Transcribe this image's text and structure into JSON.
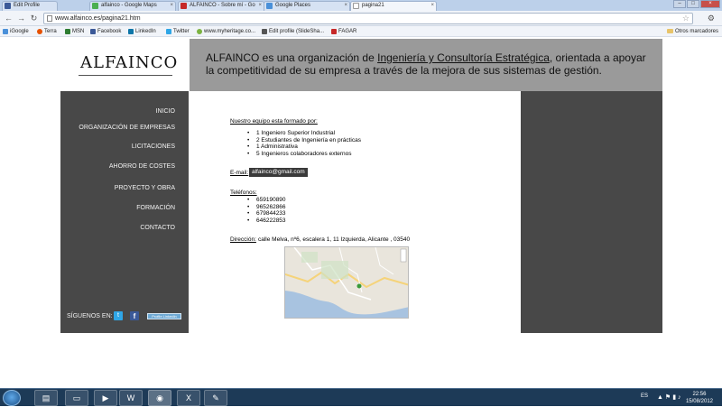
{
  "browser": {
    "tabs": [
      {
        "label": "Edit Profile",
        "color": "#3b5998"
      },
      {
        "label": "alfainco - Google Maps",
        "color": "#4caf50"
      },
      {
        "label": "ALFAINCO - Sobre mí - Go",
        "color": "#c62828"
      },
      {
        "label": "Google Places",
        "color": "#4a90d9"
      },
      {
        "label": "pagina21",
        "color": "#ffffff"
      }
    ],
    "url": "www.alfainco.es/pagina21.htm",
    "bookmarks": [
      {
        "label": "iGoogle",
        "color": "#4a90d9"
      },
      {
        "label": "Terra",
        "color": "#e65100"
      },
      {
        "label": "MSN",
        "color": "#2e7d32"
      },
      {
        "label": "Facebook",
        "color": "#3b5998"
      },
      {
        "label": "LinkedIn",
        "color": "#0e76a8"
      },
      {
        "label": "Twitter",
        "color": "#2fa6e6"
      },
      {
        "label": "www.myheritage.co...",
        "color": "#7cb342"
      },
      {
        "label": "Edit profile (SlideSha...",
        "color": "#555555"
      },
      {
        "label": "FAGAR",
        "color": "#c62828"
      }
    ],
    "other_bookmarks": "Otros marcadores"
  },
  "site": {
    "logo": "ALFAINCO",
    "header": {
      "part1": "ALFAINCO es una organización de ",
      "link": "Ingeniería y Consultoría Estratégica",
      "part2": ", orientada a apoyar la competitividad de su empresa a través de la mejora de sus sistemas de gestión."
    },
    "nav": [
      "INICIO",
      "ORGANIZACIÓN DE EMPRESAS",
      "LICITACIONES",
      "AHORRO DE COSTES",
      "PROYECTO Y OBRA",
      "FORMACIÓN",
      "CONTACTO"
    ],
    "follow_label": "SÍGUENOS EN:",
    "linkedin_badge": "Profile LinkedIn",
    "team_heading": "Nuestro equipo esta formado por:",
    "team": [
      "1 Ingeniero Superior Industrial",
      "2 Estudiantes de Ingeniería en prácticas",
      "1 Administrativa",
      "5 Ingenieros colaboradores externos"
    ],
    "email_label": "E-mail:",
    "email": "alfainco@gmail.com",
    "phones_label": "Teléfonos:",
    "phones": [
      "659190890",
      "965262866",
      "679844233",
      "646222853"
    ],
    "address_label": "Dirección:",
    "address": "calle Melva, nº6, escalera 1, 11 Izquierda, Alicante , 03540"
  },
  "taskbar": {
    "language": "ES",
    "time": "22:56",
    "date": "15/08/2012"
  }
}
